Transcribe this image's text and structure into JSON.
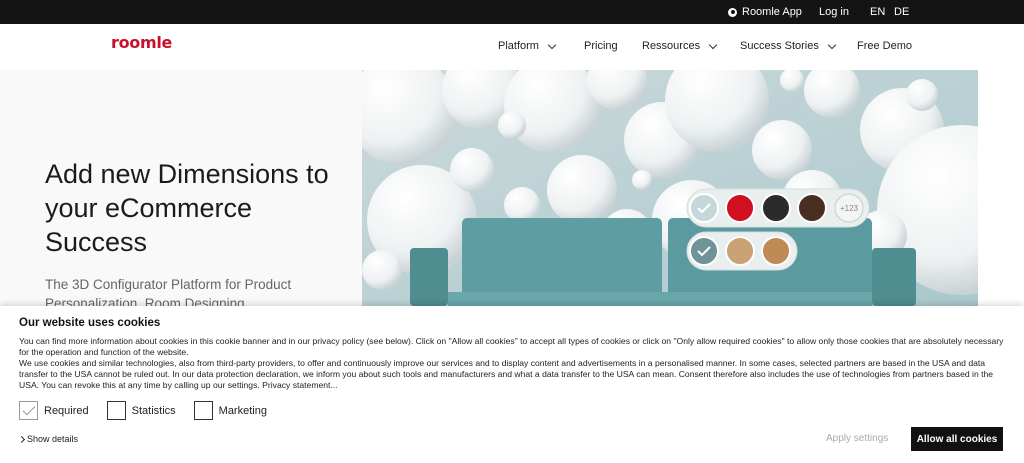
{
  "topbar": {
    "app_label": "Roomle App",
    "login": "Log in",
    "lang_en": "EN",
    "lang_de": "DE"
  },
  "brand": "roomle",
  "nav": {
    "platform": "Platform",
    "pricing": "Pricing",
    "ressources": "Ressources",
    "success": "Success Stories",
    "demo": "Free Demo"
  },
  "hero": {
    "title": "Add new Dimensions to your eCommerce Success",
    "subtitle": "The 3D Configurator Platform for Product Personalization, Room Designing",
    "swatch_more": "+123"
  },
  "colors": {
    "accent": "#c8102e",
    "sofa": "#5e9ea2",
    "swatch_red": "#d0101f",
    "swatch_black": "#2b2b2b",
    "swatch_brown": "#4a2e22"
  },
  "cookie": {
    "title": "Our website uses cookies",
    "p1": "You can find more information about cookies in this cookie banner and in our privacy policy (see below). Click on \"Allow all cookies\" to accept all types of cookies or click on \"Only allow required cookies\" to allow only those cookies that are absolutely necessary for the operation and function of the website.",
    "p2": "We use cookies and similar technologies, also from third-party providers, to offer and continuously improve our services and to display content and advertisements in a personalised manner. In some cases, selected partners are based in the USA and data transfer to the USA cannot be ruled out. In our data protection declaration, we inform you about such tools and manufacturers and what a data transfer to the USA can mean. Consent therefore also includes the use of technologies from partners based in the USA. You can revoke this at any time by calling up our settings. Privacy statement...",
    "required": "Required",
    "statistics": "Statistics",
    "marketing": "Marketing",
    "show_details": "Show details",
    "apply": "Apply settings",
    "allow_all": "Allow all cookies"
  }
}
